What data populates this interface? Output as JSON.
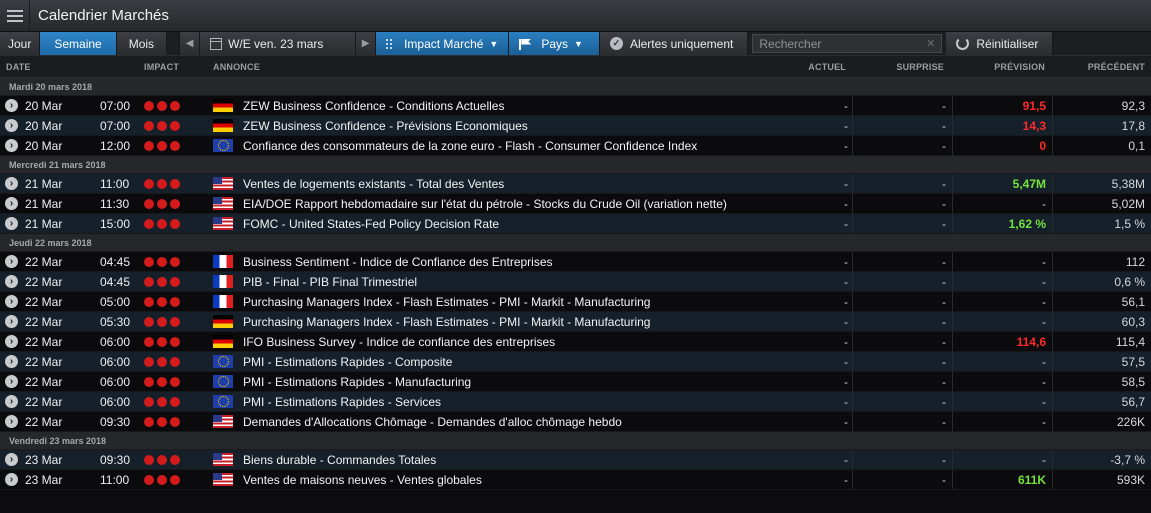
{
  "app": {
    "title": "Calendrier Marchés"
  },
  "toolbar": {
    "tab_day": "Jour",
    "tab_week": "Semaine",
    "tab_month": "Mois",
    "week_label": "W/E ven. 23 mars",
    "impact_label": "Impact Marché",
    "country_label": "Pays",
    "alerts_label": "Alertes uniquement",
    "search_placeholder": "Rechercher",
    "reset_label": "Réinitialiser"
  },
  "columns": {
    "date": "DATE",
    "impact": "IMPACT",
    "announcement": "ANNONCE",
    "actual": "ACTUEL",
    "surprise": "SURPRISE",
    "forecast": "PRÉVISION",
    "previous": "PRÉCÉDENT"
  },
  "groups": [
    {
      "label": "Mardi 20 mars 2018",
      "rows": [
        {
          "date": "20 Mar",
          "time": "07:00",
          "flag": "de",
          "title": "ZEW Business Confidence - Conditions Actuelles",
          "actual": "-",
          "surprise": "-",
          "forecast": "91,5",
          "forecast_color": "red",
          "previous": "92,3"
        },
        {
          "date": "20 Mar",
          "time": "07:00",
          "flag": "de",
          "title": "ZEW Business Confidence - Prévisions Economiques",
          "actual": "-",
          "surprise": "-",
          "forecast": "14,3",
          "forecast_color": "red",
          "previous": "17,8"
        },
        {
          "date": "20 Mar",
          "time": "12:00",
          "flag": "eu",
          "title": "Confiance des consommateurs de la zone euro - Flash - Consumer Confidence Index",
          "actual": "-",
          "surprise": "-",
          "forecast": "0",
          "forecast_color": "red",
          "previous": "0,1"
        }
      ]
    },
    {
      "label": "Mercredi 21 mars 2018",
      "rows": [
        {
          "date": "21 Mar",
          "time": "11:00",
          "flag": "us",
          "title": "Ventes de logements existants - Total des Ventes",
          "actual": "-",
          "surprise": "-",
          "forecast": "5,47M",
          "forecast_color": "green",
          "previous": "5,38M"
        },
        {
          "date": "21 Mar",
          "time": "11:30",
          "flag": "us",
          "title": "EIA/DOE Rapport hebdomadaire sur l'état du pétrole - Stocks du Crude Oil (variation nette)",
          "actual": "-",
          "surprise": "-",
          "forecast": "-",
          "forecast_color": "plain",
          "previous": "5,02M"
        },
        {
          "date": "21 Mar",
          "time": "15:00",
          "flag": "us",
          "title": "FOMC - United States-Fed Policy Decision Rate",
          "actual": "-",
          "surprise": "-",
          "forecast": "1,62 %",
          "forecast_color": "green",
          "previous": "1,5 %"
        }
      ]
    },
    {
      "label": "Jeudi 22 mars 2018",
      "rows": [
        {
          "date": "22 Mar",
          "time": "04:45",
          "flag": "fr",
          "title": "Business Sentiment - Indice de Confiance des Entreprises",
          "actual": "-",
          "surprise": "-",
          "forecast": "-",
          "forecast_color": "plain",
          "previous": "112"
        },
        {
          "date": "22 Mar",
          "time": "04:45",
          "flag": "fr",
          "title": "PIB - Final - PIB Final Trimestriel",
          "actual": "-",
          "surprise": "-",
          "forecast": "-",
          "forecast_color": "plain",
          "previous": "0,6 %"
        },
        {
          "date": "22 Mar",
          "time": "05:00",
          "flag": "fr",
          "title": "Purchasing Managers Index - Flash Estimates - PMI - Markit - Manufacturing",
          "actual": "-",
          "surprise": "-",
          "forecast": "-",
          "forecast_color": "plain",
          "previous": "56,1"
        },
        {
          "date": "22 Mar",
          "time": "05:30",
          "flag": "de",
          "title": "Purchasing Managers Index - Flash Estimates - PMI - Markit - Manufacturing",
          "actual": "-",
          "surprise": "-",
          "forecast": "-",
          "forecast_color": "plain",
          "previous": "60,3"
        },
        {
          "date": "22 Mar",
          "time": "06:00",
          "flag": "de",
          "title": "IFO Business Survey - Indice de confiance des entreprises",
          "actual": "-",
          "surprise": "-",
          "forecast": "114,6",
          "forecast_color": "red",
          "previous": "115,4"
        },
        {
          "date": "22 Mar",
          "time": "06:00",
          "flag": "eu",
          "title": "PMI - Estimations Rapides - Composite",
          "actual": "-",
          "surprise": "-",
          "forecast": "-",
          "forecast_color": "plain",
          "previous": "57,5"
        },
        {
          "date": "22 Mar",
          "time": "06:00",
          "flag": "eu",
          "title": "PMI - Estimations Rapides - Manufacturing",
          "actual": "-",
          "surprise": "-",
          "forecast": "-",
          "forecast_color": "plain",
          "previous": "58,5"
        },
        {
          "date": "22 Mar",
          "time": "06:00",
          "flag": "eu",
          "title": "PMI - Estimations Rapides - Services",
          "actual": "-",
          "surprise": "-",
          "forecast": "-",
          "forecast_color": "plain",
          "previous": "56,7"
        },
        {
          "date": "22 Mar",
          "time": "09:30",
          "flag": "us",
          "title": "Demandes d'Allocations Chômage - Demandes d'alloc chômage hebdo",
          "actual": "-",
          "surprise": "-",
          "forecast": "-",
          "forecast_color": "plain",
          "previous": "226K"
        }
      ]
    },
    {
      "label": "Vendredi 23 mars 2018",
      "rows": [
        {
          "date": "23 Mar",
          "time": "09:30",
          "flag": "us",
          "title": "Biens durable - Commandes Totales",
          "actual": "-",
          "surprise": "-",
          "forecast": "-",
          "forecast_color": "plain",
          "previous": "-3,7 %"
        },
        {
          "date": "23 Mar",
          "time": "11:00",
          "flag": "us",
          "title": "Ventes de maisons neuves - Ventes globales",
          "actual": "-",
          "surprise": "-",
          "forecast": "611K",
          "forecast_color": "green",
          "previous": "593K"
        }
      ]
    }
  ]
}
